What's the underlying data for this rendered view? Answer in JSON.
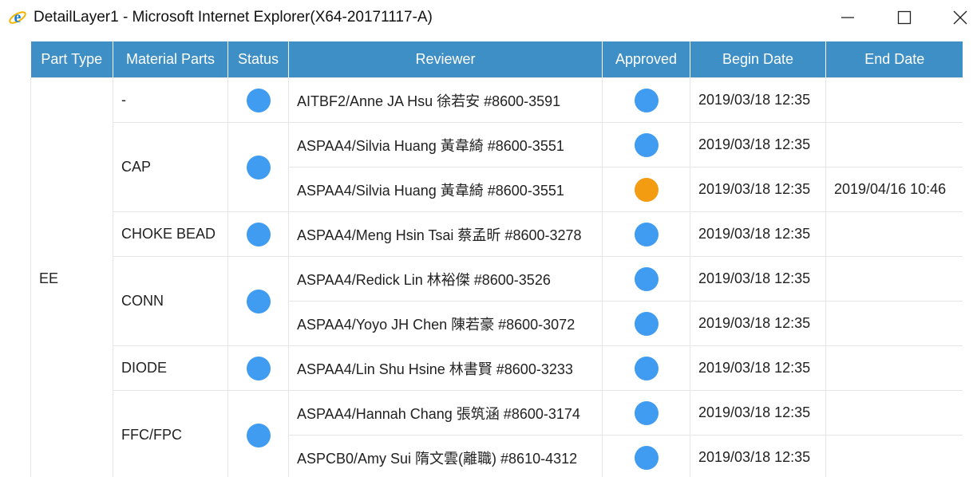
{
  "window": {
    "title": "DetailLayer1 - Microsoft Internet Explorer(X64-20171117-A)",
    "minimize_glyph": "—",
    "maximize_glyph": "☐",
    "close_glyph": "✕"
  },
  "colors": {
    "header_bg": "#3d8fc6",
    "status_blue": "#3f9cf0",
    "status_orange": "#f39c12"
  },
  "table": {
    "headers": [
      "Part Type",
      "Material Parts",
      "Status",
      "Reviewer",
      "Approved",
      "Begin Date",
      "End Date"
    ],
    "part_type": "EE",
    "groups": [
      {
        "material": "-",
        "status": "blue",
        "rows": [
          {
            "reviewer": "AITBF2/Anne JA Hsu 徐若安 #8600-3591",
            "approved": "blue",
            "begin": "2019/03/18 12:35",
            "end": ""
          }
        ]
      },
      {
        "material": "CAP",
        "status": "blue",
        "rows": [
          {
            "reviewer": "ASPAA4/Silvia Huang 黃韋綺 #8600-3551",
            "approved": "blue",
            "begin": "2019/03/18 12:35",
            "end": ""
          },
          {
            "reviewer": "ASPAA4/Silvia Huang 黃韋綺 #8600-3551",
            "approved": "orange",
            "begin": "2019/03/18 12:35",
            "end": "2019/04/16 10:46"
          }
        ]
      },
      {
        "material": "CHOKE BEAD",
        "status": "blue",
        "rows": [
          {
            "reviewer": "ASPAA4/Meng Hsin Tsai 蔡孟昕 #8600-3278",
            "approved": "blue",
            "begin": "2019/03/18 12:35",
            "end": ""
          }
        ]
      },
      {
        "material": "CONN",
        "status": "blue",
        "rows": [
          {
            "reviewer": "ASPAA4/Redick Lin 林裕傑 #8600-3526",
            "approved": "blue",
            "begin": "2019/03/18 12:35",
            "end": ""
          },
          {
            "reviewer": "ASPAA4/Yoyo JH Chen 陳若豪 #8600-3072",
            "approved": "blue",
            "begin": "2019/03/18 12:35",
            "end": ""
          }
        ]
      },
      {
        "material": "DIODE",
        "status": "blue",
        "rows": [
          {
            "reviewer": "ASPAA4/Lin Shu Hsine 林書賢 #8600-3233",
            "approved": "blue",
            "begin": "2019/03/18 12:35",
            "end": ""
          }
        ]
      },
      {
        "material": "FFC/FPC",
        "status": "blue",
        "rows": [
          {
            "reviewer": "ASPAA4/Hannah Chang 張筑涵 #8600-3174",
            "approved": "blue",
            "begin": "2019/03/18 12:35",
            "end": ""
          },
          {
            "reviewer": "ASPCB0/Amy Sui 隋文雲(離職) #8610-4312",
            "approved": "blue",
            "begin": "2019/03/18 12:35",
            "end": ""
          }
        ]
      }
    ]
  }
}
